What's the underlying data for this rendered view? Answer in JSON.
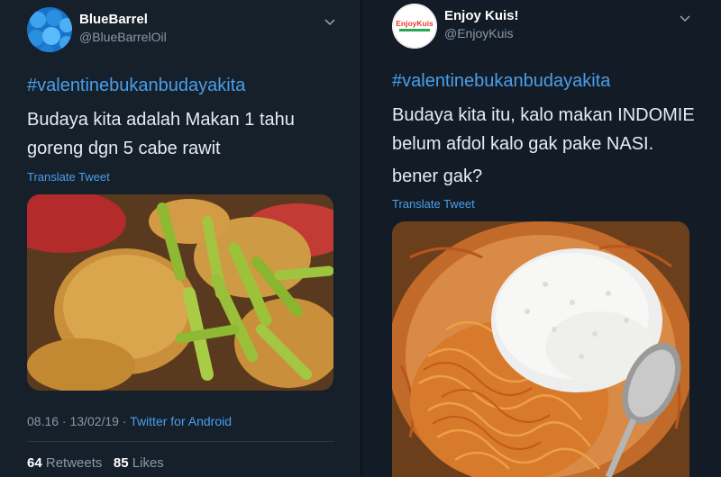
{
  "left": {
    "author": {
      "name": "BlueBarrel",
      "handle": "@BlueBarrelOil",
      "avatar_icon": "blue-barrels-avatar"
    },
    "hashtag": "#valentinebukanbudayakita",
    "lines": [
      "Budaya kita adalah Makan 1 tahu",
      "goreng dgn 5 cabe rawit"
    ],
    "translate": "Translate Tweet",
    "image_icon": "fried-tofu-and-chili-photo",
    "time": "08.16 · 13/02/19 · ",
    "client": "Twitter for Android",
    "retweets_count": "64",
    "retweets_label": "Retweets",
    "likes_count": "85",
    "likes_label": "Likes"
  },
  "right": {
    "author": {
      "name": "Enjoy Kuis!",
      "handle": "@EnjoyKuis",
      "avatar_icon": "enjoy-kuis-logo",
      "logo_text": "EnjoyKuis"
    },
    "hashtag": "#valentinebukanbudayakita",
    "lines": [
      "Budaya kita itu, kalo makan INDOMIE",
      "belum afdol kalo gak pake NASI."
    ],
    "line2": "bener gak?",
    "translate": "Translate Tweet",
    "image_icon": "instant-noodles-and-rice-photo"
  },
  "colors": {
    "background": "#15202b",
    "link": "#4a9eeb",
    "muted": "#8899a6"
  }
}
